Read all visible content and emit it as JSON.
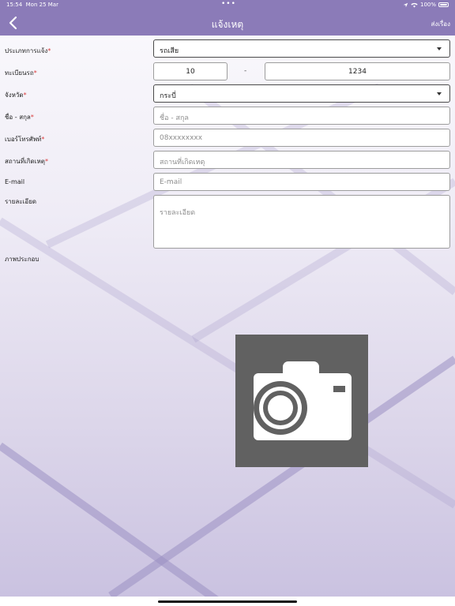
{
  "status_bar": {
    "time": "15:54",
    "date": "Mon 25 Mar",
    "battery": "100%"
  },
  "nav": {
    "title": "แจ้งเหตุ",
    "action": "ส่งเรื่อง"
  },
  "form": {
    "type": {
      "label": "ประเภทการแจ้ง",
      "value": "รถเสีย"
    },
    "plate": {
      "label": "ทะเบียนรถ",
      "part1": "10",
      "separator": "-",
      "part2": "1234"
    },
    "province": {
      "label": "จังหวัด",
      "value": "กระบี่"
    },
    "name": {
      "label": "ชื่อ - สกุล",
      "placeholder": "ชื่อ - สกุล"
    },
    "phone": {
      "label": "เบอร์โทรศัพท์",
      "placeholder": "08xxxxxxxx"
    },
    "location": {
      "label": "สถานที่เกิดเหตุ",
      "placeholder": "สถานที่เกิดเหตุ"
    },
    "email": {
      "label": "E-mail",
      "placeholder": "E-mail"
    },
    "details": {
      "label": "รายละเอียด",
      "placeholder": "รายละเอียด"
    },
    "photo": {
      "label": "ภาพประกอบ"
    },
    "required_mark": "*"
  },
  "icons": {
    "back": "chevron-left-icon",
    "camera": "camera-icon"
  },
  "colors": {
    "header": "#8b7bb8",
    "required": "#d93a3a",
    "camera_bg": "#616161"
  }
}
